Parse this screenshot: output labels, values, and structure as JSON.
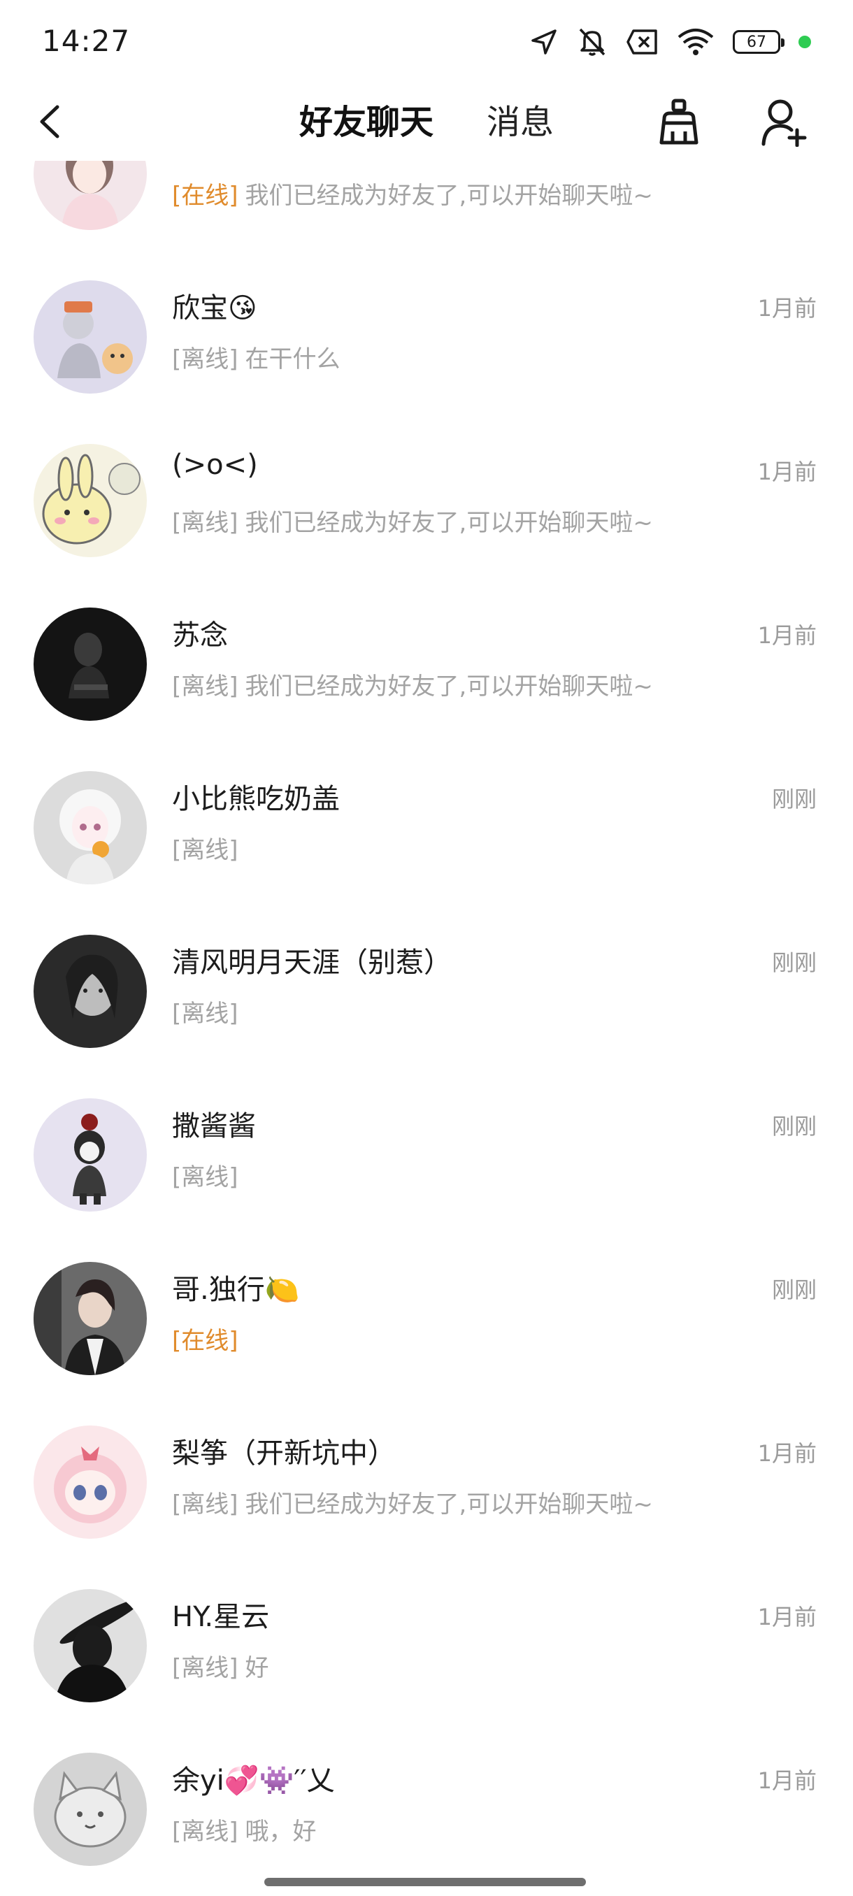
{
  "status_bar": {
    "time": "14:27",
    "battery": "67",
    "icons": [
      "location-arrow-icon",
      "bell-muted-icon",
      "close-box-icon",
      "wifi-icon",
      "battery-icon",
      "green-dot-icon"
    ]
  },
  "header": {
    "tabs": [
      {
        "label": "好友聊天",
        "active": true
      },
      {
        "label": "消息",
        "active": false
      }
    ],
    "back_icon": "chevron-left-icon",
    "clean_icon": "broom-icon",
    "add_friend_icon": "add-user-icon"
  },
  "colors": {
    "online": "#e08b2c",
    "offline": "#a3a3a3",
    "name": "#1c1c1c",
    "time": "#9b9b9b"
  },
  "chats": [
    {
      "name": "",
      "time": "",
      "status": "[在线]",
      "online": true,
      "preview": "我们已经成为好友了,可以开始聊天啦~",
      "avatar_color": "#f1dfe5"
    },
    {
      "name": "欣宝😘",
      "time": "1月前",
      "status": "[离线]",
      "online": false,
      "preview": "在干什么",
      "avatar_color": "#dcd8ea"
    },
    {
      "name": "(>o<)",
      "time": "1月前",
      "status": "[离线]",
      "online": false,
      "preview": "我们已经成为好友了,可以开始聊天啦~",
      "avatar_color": "#f4f0cf"
    },
    {
      "name": "苏念",
      "time": "1月前",
      "status": "[离线]",
      "online": false,
      "preview": "我们已经成为好友了,可以开始聊天啦~",
      "avatar_color": "#202020"
    },
    {
      "name": "小比熊吃奶盖",
      "time": "刚刚",
      "status": "[离线]",
      "online": false,
      "preview": "",
      "avatar_color": "#e2e2e2"
    },
    {
      "name": "清风明月天涯（别惹）",
      "time": "刚刚",
      "status": "[离线]",
      "online": false,
      "preview": "",
      "avatar_color": "#3a3a3a"
    },
    {
      "name": "撒酱酱",
      "time": "刚刚",
      "status": "[离线]",
      "online": false,
      "preview": "",
      "avatar_color": "#e4e0ee"
    },
    {
      "name": "哥.独行🍋",
      "time": "刚刚",
      "status": "[在线]",
      "online": true,
      "preview": "",
      "avatar_color": "#5a5a5a"
    },
    {
      "name": "梨筝（开新坑中）",
      "time": "1月前",
      "status": "[离线]",
      "online": false,
      "preview": "我们已经成为好友了,可以开始聊天啦~",
      "avatar_color": "#f6dbe0"
    },
    {
      "name": "HY.星云",
      "time": "1月前",
      "status": "[离线]",
      "online": false,
      "preview": "好",
      "avatar_color": "#d8d8d8"
    },
    {
      "name": "余yi💞👾′′乂",
      "time": "1月前",
      "status": "[离线]",
      "online": false,
      "preview": "哦，好",
      "avatar_color": "#cfcfcf"
    }
  ]
}
